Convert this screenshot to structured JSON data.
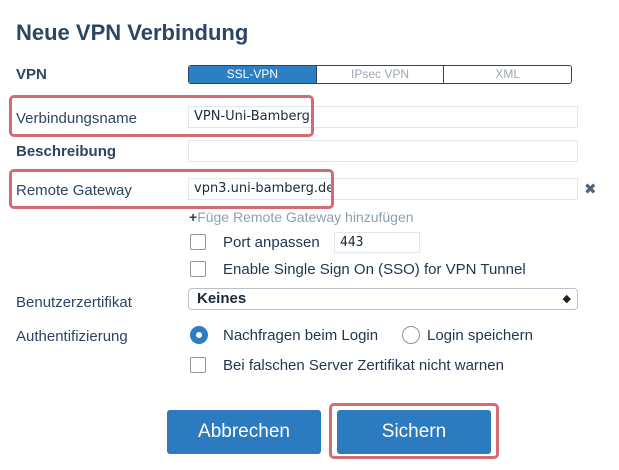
{
  "page_title": "Neue VPN Verbindung",
  "labels": {
    "vpn": "VPN",
    "connection_name": "Verbindungsname",
    "description": "Beschreibung",
    "remote_gateway": "Remote Gateway",
    "user_certificate": "Benutzerzertifikat",
    "authentication": "Authentifizierung"
  },
  "vpn_tabs": [
    {
      "label": "SSL-VPN",
      "active": true
    },
    {
      "label": "IPsec VPN",
      "active": false
    },
    {
      "label": "XML",
      "active": false
    }
  ],
  "fields": {
    "connection_name": "VPN-Uni-Bamberg",
    "description": "",
    "remote_gateway": "vpn3.uni-bamberg.de",
    "port": "443"
  },
  "icons": {
    "remove_gateway": "close-icon",
    "add_gateway": "plus-icon",
    "select_arrows": "updown-arrow-icon",
    "remove_gateway_glyph": "✖",
    "add_gateway_glyph": "+",
    "select_arrows_glyph": "◆"
  },
  "add_gateway_link": "Füge Remote Gateway hinzufügen",
  "options": {
    "custom_port": {
      "label": "Port anpassen",
      "checked": false
    },
    "sso": {
      "label": "Enable Single Sign On (SSO) for VPN Tunnel",
      "checked": false
    },
    "no_warn_cert": {
      "label": "Bei falschen Server Zertifikat nicht warnen",
      "checked": false
    }
  },
  "certificate_select": {
    "selected": "Keines"
  },
  "auth_radios": [
    {
      "label": "Nachfragen beim Login",
      "selected": true
    },
    {
      "label": "Login speichern",
      "selected": false
    }
  ],
  "buttons": {
    "cancel": "Abbrechen",
    "save": "Sichern"
  },
  "colors": {
    "accent": "#2d7fc4",
    "title": "#2c4563",
    "highlight": "#d26b73"
  }
}
